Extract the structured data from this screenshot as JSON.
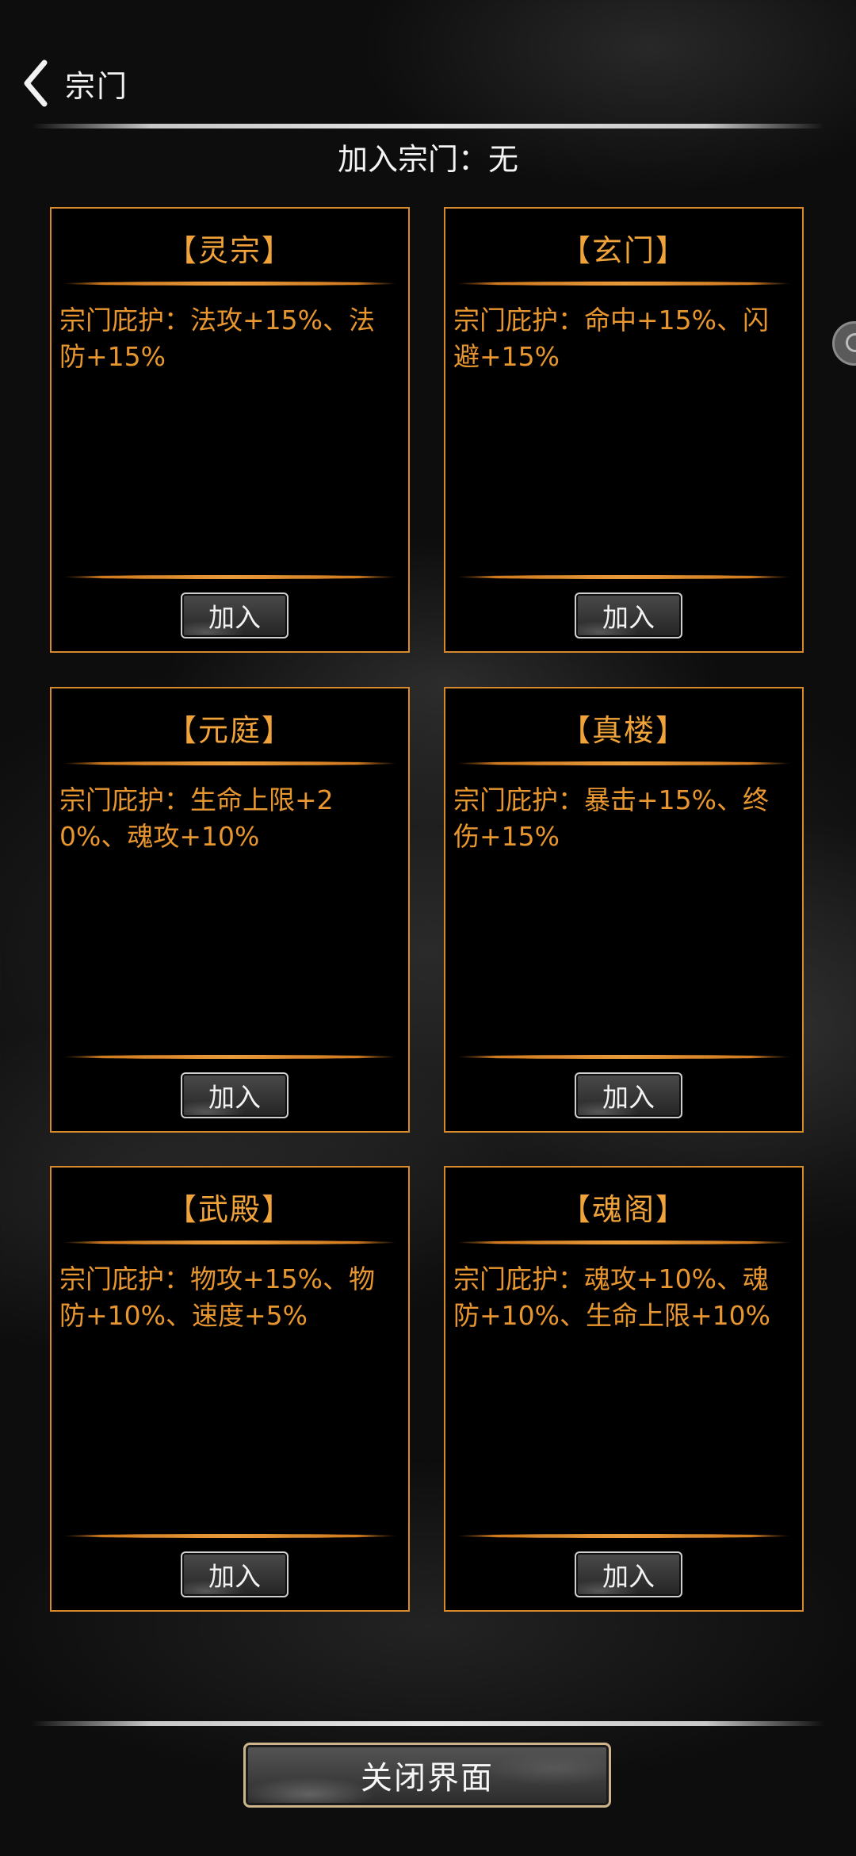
{
  "header": {
    "back_icon": "chevron-left-icon",
    "title": "宗门"
  },
  "join_status": "加入宗门：无",
  "sects": [
    {
      "name": "【灵宗】",
      "description": "宗门庇护：法攻+15%、法防+15%",
      "button_label": "加入"
    },
    {
      "name": "【玄门】",
      "description": "宗门庇护：命中+15%、闪避+15%",
      "button_label": "加入"
    },
    {
      "name": "【元庭】",
      "description": "宗门庇护：生命上限+20%、魂攻+10%",
      "button_label": "加入"
    },
    {
      "name": "【真楼】",
      "description": "宗门庇护：暴击+15%、终伤+15%",
      "button_label": "加入"
    },
    {
      "name": "【武殿】",
      "description": "宗门庇护：物攻+15%、物防+10%、速度+5%",
      "button_label": "加入"
    },
    {
      "name": "【魂阁】",
      "description": "宗门庇护：魂攻+10%、魂防+10%、生命上限+10%",
      "button_label": "加入"
    }
  ],
  "close_button_label": "关闭界面",
  "colors": {
    "accent_orange": "#e8962f",
    "card_border": "#d8892a",
    "background": "#101010",
    "text_light": "#f4f4f4"
  }
}
